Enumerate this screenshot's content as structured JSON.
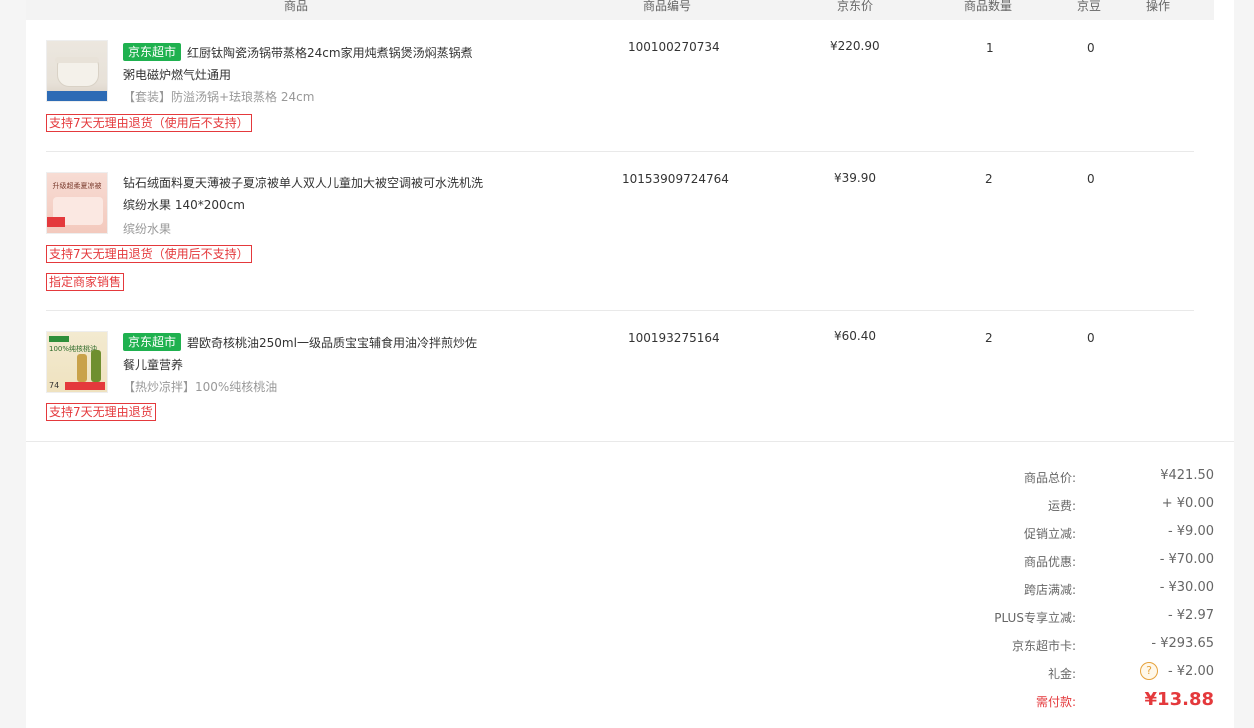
{
  "table_header": {
    "product": "商品",
    "product_id": "商品编号",
    "price": "京东价",
    "quantity": "商品数量",
    "jingdou": "京豆",
    "action": "操作"
  },
  "items": [
    {
      "supermarket_tag": "京东超市",
      "name": "红厨钛陶瓷汤锅带蒸格24cm家用炖煮锅煲汤焖蒸锅煮粥电磁炉燃气灶通用",
      "spec": "【套装】防溢汤锅+珐琅蒸格 24cm",
      "badges": [
        "支持7天无理由退货（使用后不支持）"
      ],
      "id": "100100270734",
      "price": "¥220.90",
      "qty": "1",
      "jingdou": "0"
    },
    {
      "supermarket_tag": "",
      "name": "钻石绒面料夏天薄被子夏凉被单人双人儿童加大被空调被可水洗机洗 缤纷水果 140*200cm",
      "spec": "缤纷水果",
      "badges": [
        "支持7天无理由退货（使用后不支持）",
        "指定商家销售"
      ],
      "id": "10153909724764",
      "price": "¥39.90",
      "qty": "2",
      "jingdou": "0"
    },
    {
      "supermarket_tag": "京东超市",
      "name": "碧欧奇核桃油250ml一级品质宝宝辅食用油冷拌煎炒佐餐儿童营养",
      "spec": "【热炒凉拌】100%纯核桃油",
      "badges": [
        "支持7天无理由退货"
      ],
      "id": "100193275164",
      "price": "¥60.40",
      "qty": "2",
      "jingdou": "0"
    }
  ],
  "summary": [
    {
      "label": "商品总价:",
      "value": "¥421.50"
    },
    {
      "label": "运费:",
      "value": "+ ¥0.00"
    },
    {
      "label": "促销立减:",
      "value": "- ¥9.00"
    },
    {
      "label": "商品优惠:",
      "value": "- ¥70.00"
    },
    {
      "label": "跨店满减:",
      "value": "- ¥30.00"
    },
    {
      "label": "PLUS专享立减:",
      "value": "- ¥2.97"
    },
    {
      "label": "京东超市卡:",
      "value": "- ¥293.65"
    },
    {
      "label": "礼金:",
      "value": "- ¥2.00"
    }
  ],
  "total": {
    "label": "需付款:",
    "value": "¥13.88"
  },
  "thumb_texts": {
    "item2_title": "升级超柔夏凉被",
    "item3_title": "100%纯核桃油",
    "item3_price": "74"
  },
  "colors": {
    "accent_red": "#e4393c",
    "jd_supermarket_green": "#1fb14f"
  }
}
